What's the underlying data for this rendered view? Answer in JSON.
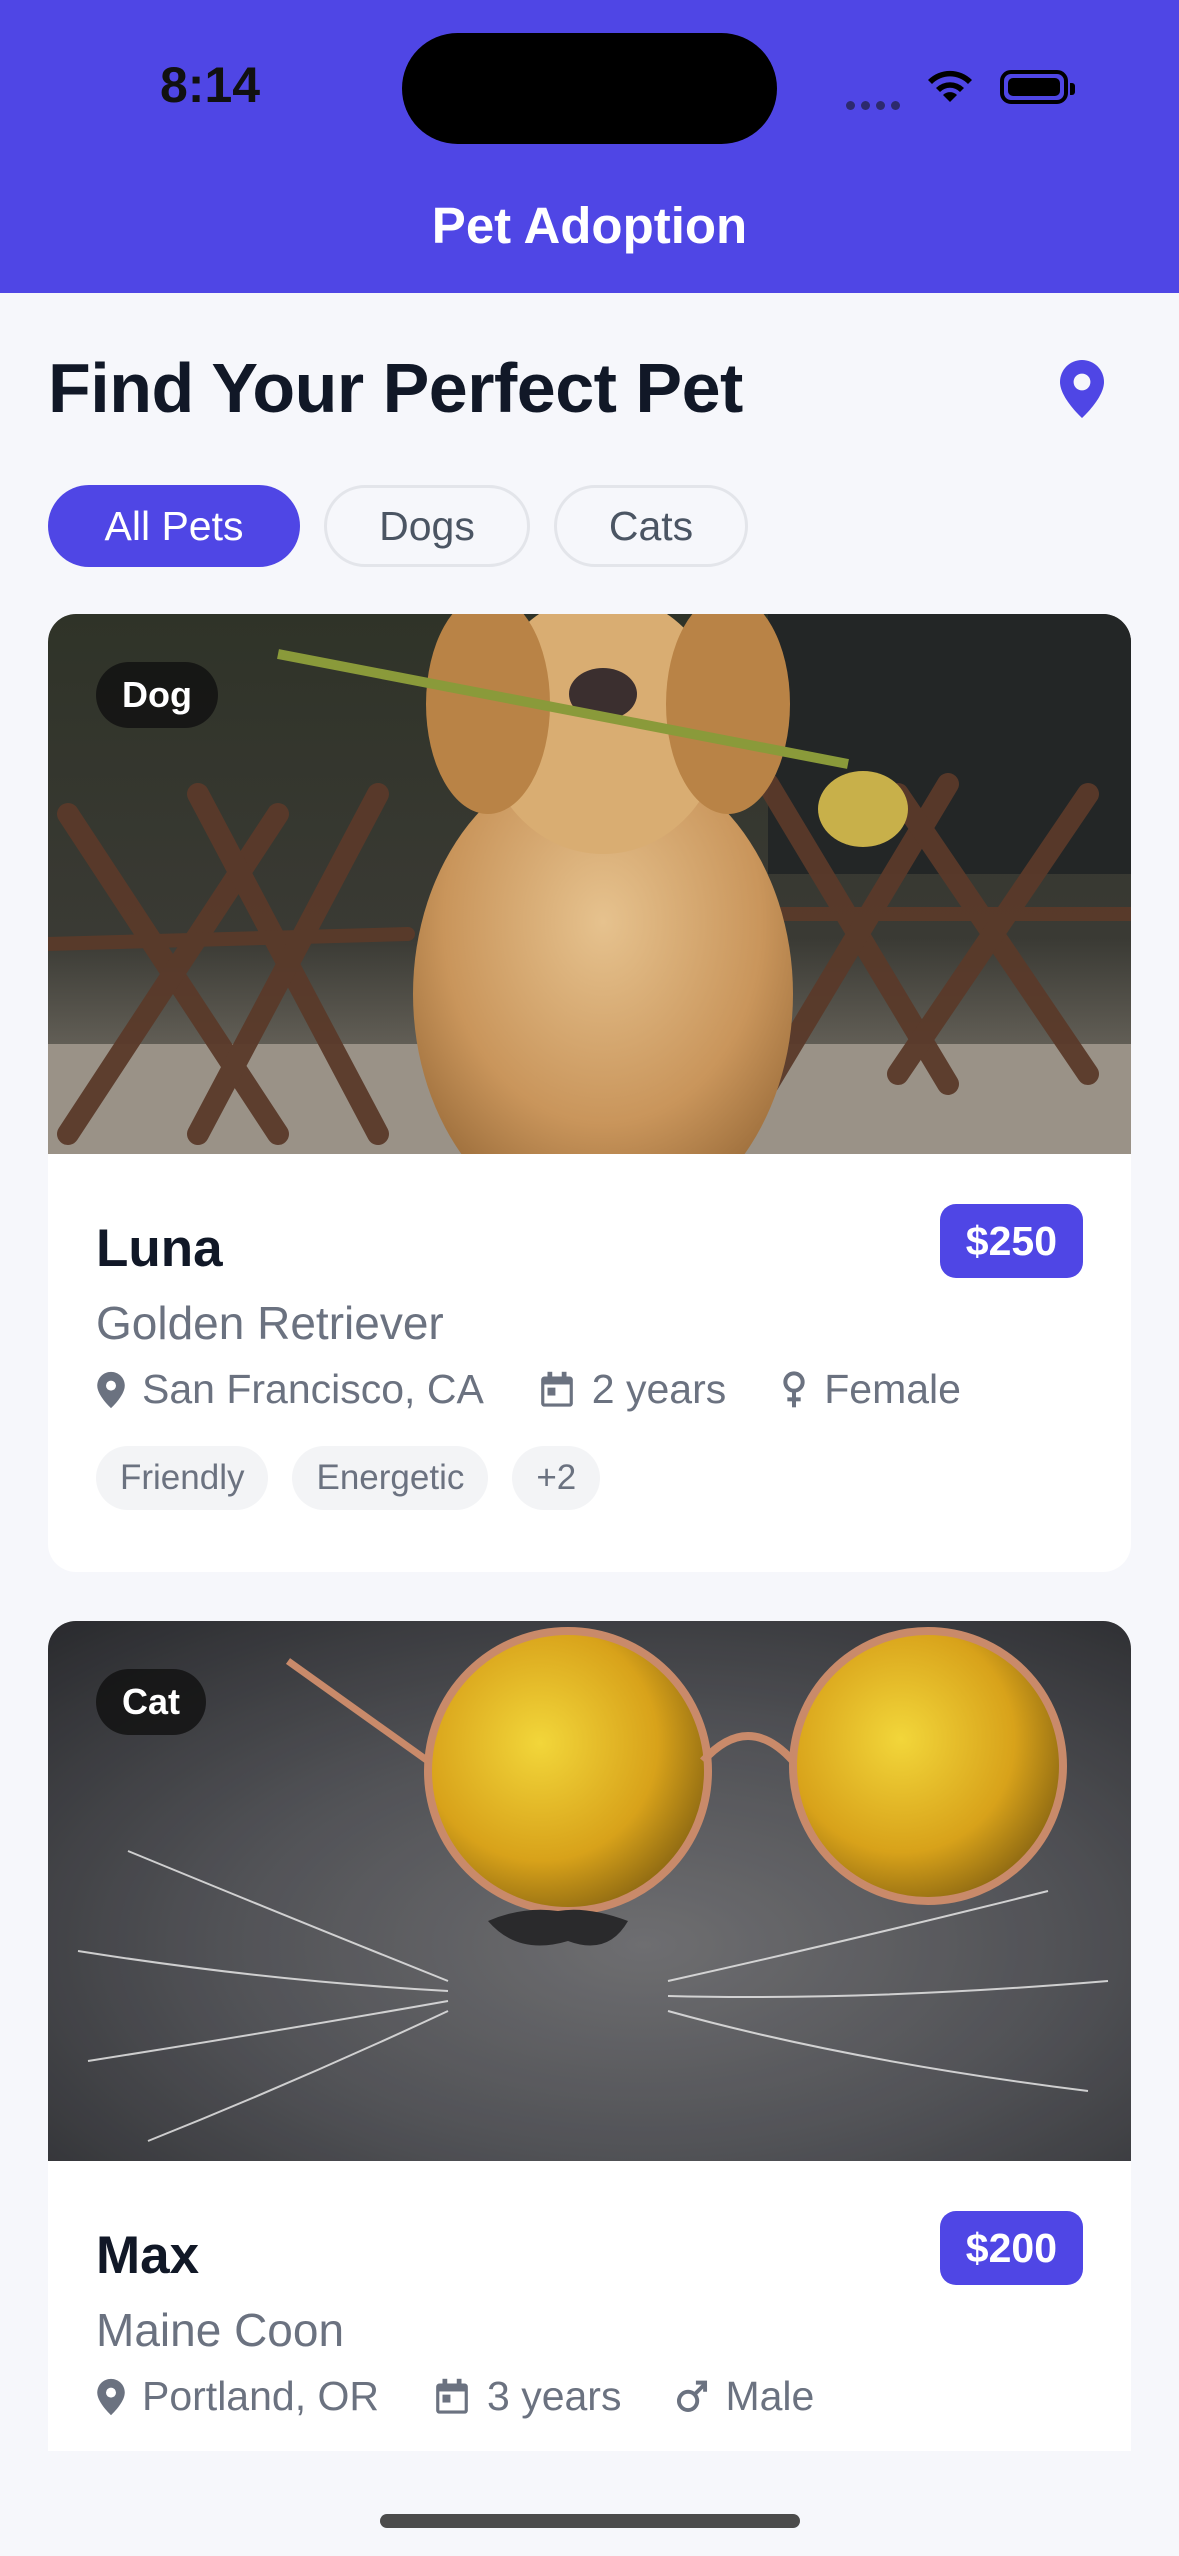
{
  "status_bar": {
    "time": "8:14"
  },
  "header": {
    "title": "Pet Adoption"
  },
  "page": {
    "title": "Find Your Perfect Pet",
    "location_icon": "map-pin-icon"
  },
  "filters": [
    {
      "label": "All Pets",
      "active": true
    },
    {
      "label": "Dogs",
      "active": false
    },
    {
      "label": "Cats",
      "active": false
    }
  ],
  "pets": [
    {
      "type": "Dog",
      "name": "Luna",
      "price": "$250",
      "breed": "Golden Retriever",
      "location": "San Francisco, CA",
      "age": "2 years",
      "gender": "Female",
      "tags": [
        "Friendly",
        "Energetic",
        "+2"
      ]
    },
    {
      "type": "Cat",
      "name": "Max",
      "price": "$200",
      "breed": "Maine Coon",
      "location": "Portland, OR",
      "age": "3 years",
      "gender": "Male",
      "tags": []
    }
  ],
  "colors": {
    "accent": "#4f46e5",
    "background": "#f6f7fb"
  }
}
